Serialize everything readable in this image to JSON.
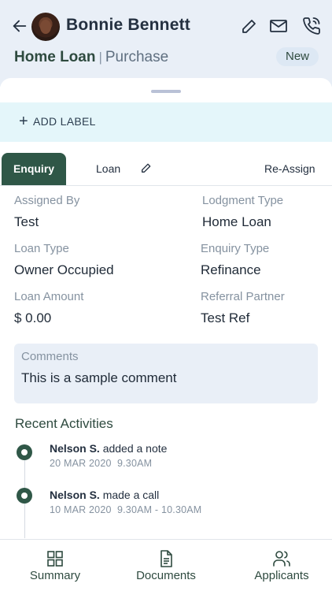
{
  "header": {
    "contact_name": "Bonnie Bennett",
    "deal_type": "Home Loan",
    "separator": "|",
    "deal_subtype": "Purchase",
    "status": "New"
  },
  "label_bar": {
    "add_label": "ADD LABEL"
  },
  "tabs": {
    "enquiry": "Enquiry",
    "loan": "Loan",
    "reassign": "Re-Assign"
  },
  "fields": {
    "assigned_by": {
      "label": "Assigned By",
      "value": "Test"
    },
    "lodgment_type": {
      "label": "Lodgment Type",
      "value": "Home Loan"
    },
    "loan_type": {
      "label": "Loan Type",
      "value": "Owner Occupied"
    },
    "enquiry_type": {
      "label": "Enquiry Type",
      "value": "Refinance"
    },
    "loan_amount": {
      "label": "Loan Amount",
      "value": "$ 0.00"
    },
    "referral_partner": {
      "label": "Referral Partner",
      "value": "Test Ref"
    }
  },
  "comments": {
    "label": "Comments",
    "value": "This is a sample comment"
  },
  "recent_activities": {
    "title": "Recent Activities",
    "items": [
      {
        "who": "Nelson S.",
        "action": "added a note",
        "when": "20 MAR 2020  9.30AM"
      },
      {
        "who": "Nelson S.",
        "action": "made a call",
        "when": "10 MAR 2020  9.30AM - 10.30AM"
      }
    ]
  },
  "bottom_nav": {
    "summary": "Summary",
    "documents": "Documents",
    "applicants": "Applicants"
  },
  "colors": {
    "accent": "#2f5747",
    "header_bg": "#e9eff7",
    "label_bar_bg": "#e4f6fa"
  },
  "icons": {
    "back": "back-arrow-icon",
    "edit": "pencil-icon",
    "mail": "mail-icon",
    "phone": "phone-icon",
    "summary": "grid-icon",
    "documents": "document-icon",
    "applicants": "users-icon"
  }
}
